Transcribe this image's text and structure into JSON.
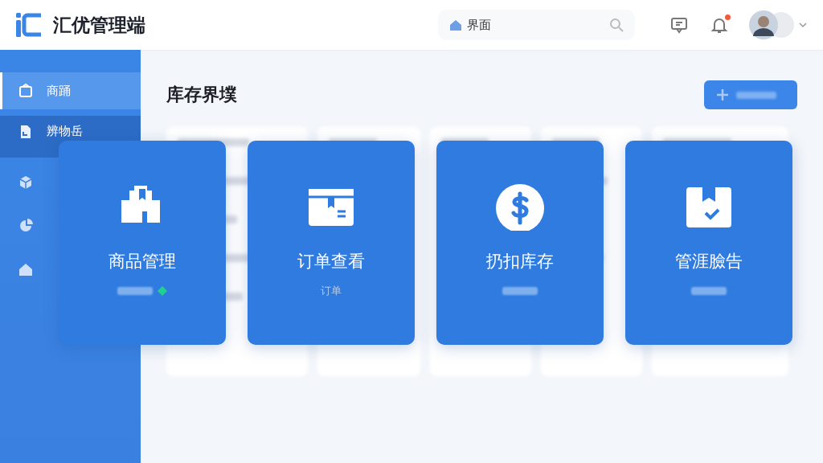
{
  "header": {
    "logo_text": "汇优管理端",
    "search": {
      "value": "界面"
    },
    "notification_badge": true
  },
  "sidebar": {
    "items": [
      {
        "label": "商踊",
        "selected": true,
        "highlighted": false
      },
      {
        "label": "辨物岳",
        "selected": false,
        "highlighted": true
      },
      {
        "selected": false,
        "highlighted": false
      },
      {
        "selected": false,
        "highlighted": false
      },
      {
        "selected": false,
        "highlighted": false
      }
    ]
  },
  "content": {
    "title": "库存界墣"
  },
  "feature_cards": [
    {
      "title": "商品管理",
      "color": "#22d08c"
    },
    {
      "title": "订单查看",
      "subtitle": "订单"
    },
    {
      "title": "扔扣库存"
    },
    {
      "title": "管涯臉告"
    }
  ]
}
